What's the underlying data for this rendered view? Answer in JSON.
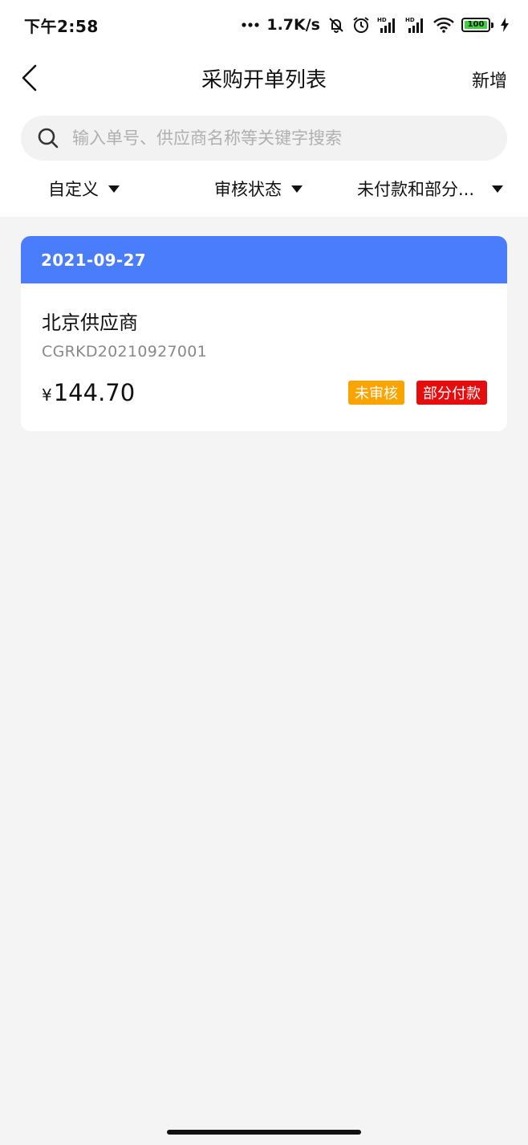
{
  "status_bar": {
    "time": "下午2:58",
    "net_speed": "1.7K/s",
    "battery": "100",
    "icons": [
      "dots-icon",
      "mute-bell-icon",
      "alarm-icon",
      "signal-hd-icon",
      "signal-hd-icon",
      "wifi-icon",
      "battery-icon",
      "charging-icon"
    ]
  },
  "nav": {
    "title": "采购开单列表",
    "add_label": "新增",
    "back_icon": "chevron-left-icon"
  },
  "search": {
    "placeholder": "输入单号、供应商名称等关键字搜索",
    "value": ""
  },
  "filters": [
    {
      "label": "自定义"
    },
    {
      "label": "审核状态"
    },
    {
      "label": "未付款和部分..."
    }
  ],
  "orders": [
    {
      "date": "2021-09-27",
      "supplier": "北京供应商",
      "order_no": "CGRKD20210927001",
      "currency": "¥",
      "amount": "144.70",
      "review_status": "未审核",
      "payment_status": "部分付款"
    }
  ],
  "colors": {
    "accent": "#4a7dfb",
    "review_badge": "#f9a400",
    "payment_badge": "#e50d0d",
    "background": "#f4f4f4"
  }
}
